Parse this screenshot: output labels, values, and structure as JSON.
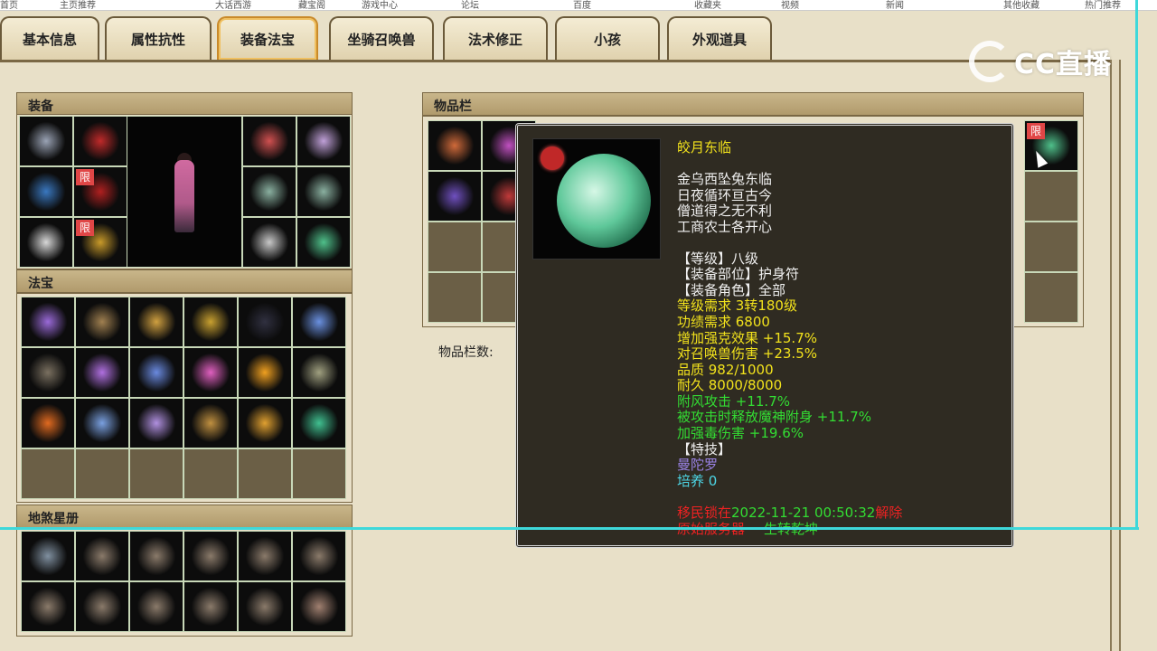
{
  "browser": {
    "bookmarks": [
      "首页",
      "主页推荐",
      "大话西游",
      "藏宝阁",
      "游戏中心",
      "论坛",
      "百度",
      "收藏夹",
      "视频",
      "新闻",
      "其他收藏",
      "热门推荐"
    ]
  },
  "tabs": [
    {
      "label": "基本信息",
      "active": false
    },
    {
      "label": "属性抗性",
      "active": false
    },
    {
      "label": "装备法宝",
      "active": true
    },
    {
      "label": "坐骑召唤兽",
      "active": false
    },
    {
      "label": "法术修正",
      "active": false
    },
    {
      "label": "小孩",
      "active": false
    },
    {
      "label": "外观道具",
      "active": false
    }
  ],
  "overlay": {
    "logo_text": "CC直播"
  },
  "equipment": {
    "title": "装备",
    "limit_badge": "限",
    "left_slots": [
      {
        "icon": "armor-cape-icon",
        "limited": false
      },
      {
        "icon": "helmet-icon",
        "limited": false
      },
      {
        "icon": "weapon-spear-icon",
        "limited": false
      },
      {
        "icon": "robe-icon",
        "limited": true
      },
      {
        "icon": "necklace-icon",
        "limited": false
      },
      {
        "icon": "boots-icon",
        "limited": true
      }
    ],
    "right_slots": [
      {
        "icon": "mask-icon",
        "limited": false
      },
      {
        "icon": "amulet-icon",
        "limited": false
      },
      {
        "icon": "ring-jade-icon",
        "limited": false
      },
      {
        "icon": "ring-jade-icon",
        "limited": false
      },
      {
        "icon": "bracelet-icon",
        "limited": false
      },
      {
        "icon": "jade-pendant-icon",
        "limited": false
      }
    ]
  },
  "treasure": {
    "title": "法宝",
    "items": [
      "lantern-icon",
      "talisman-icon",
      "gourd-icon",
      "pagoda-icon",
      "dark-orb-icon",
      "claw-icon",
      "scroll-icon",
      "whip-icon",
      "scroll-blue-icon",
      "lamp-icon",
      "cloud-icon",
      "cauldron-icon",
      "seal-icon",
      "fan-icon",
      "bell-icon",
      "staff-icon",
      "mountain-icon",
      "jade-disc-icon",
      "",
      "",
      "",
      "",
      "",
      ""
    ]
  },
  "star_book": {
    "title": "地煞星册",
    "items": [
      "warrior-card-icon",
      "monk-card-icon",
      "monk-card-icon",
      "monk-card-icon",
      "monk-card-icon",
      "monk-card-icon",
      "monk-card-icon",
      "monk-card-icon",
      "monk-card-icon",
      "monk-card-icon",
      "monk-card-icon",
      "elder-card-icon"
    ]
  },
  "inventory": {
    "title": "物品栏",
    "capacity_label": "物品栏数:",
    "limit_badge": "限",
    "visible_items": [
      "rope-icon",
      "orb-purple-icon",
      "purple-scroll-icon",
      "red-item-icon",
      "jade-pendant-icon"
    ]
  },
  "tooltip": {
    "name": "皎月东临",
    "poem": [
      "金乌西坠兔东临",
      "日夜循环亘古今",
      "僧道得之无不利",
      "工商农士各开心"
    ],
    "level": "【等级】八级",
    "slot": "【装备部位】护身符",
    "role": "【装备角色】全部",
    "requirements": [
      "等级需求 3转180级",
      "功绩需求 6800",
      "增加强克效果 +15.7%",
      "对召唤兽伤害 +23.5%",
      "品质 982/1000",
      "耐久 8000/8000"
    ],
    "bonuses": [
      "附风攻击 +11.7%",
      "被攻击时释放魔神附身 +11.7%",
      "加强毒伤害 +19.6%"
    ],
    "skill_header": "【特技】",
    "skill": "曼陀罗",
    "nurture": "培养 0",
    "lock_prefix": "移民锁在",
    "lock_time": "2022-11-21 00:50:32",
    "lock_suffix": "解除",
    "origin_prefix": "原始服务器",
    "origin_server": "一生转乾坤"
  },
  "colors": {
    "tab_border": "#6b5a3a",
    "active_tab_border": "#c98a2a",
    "tooltip_bg": "#2f2b22",
    "text_white": "#f0f0f0",
    "text_yellow": "#f2e21c",
    "text_green": "#33dd33",
    "text_purple": "#9b83e8",
    "text_cyan": "#4dd6e6",
    "text_red": "#ee2222",
    "stream_frame": "#3ed8da",
    "limit_badge": "#e04646"
  }
}
